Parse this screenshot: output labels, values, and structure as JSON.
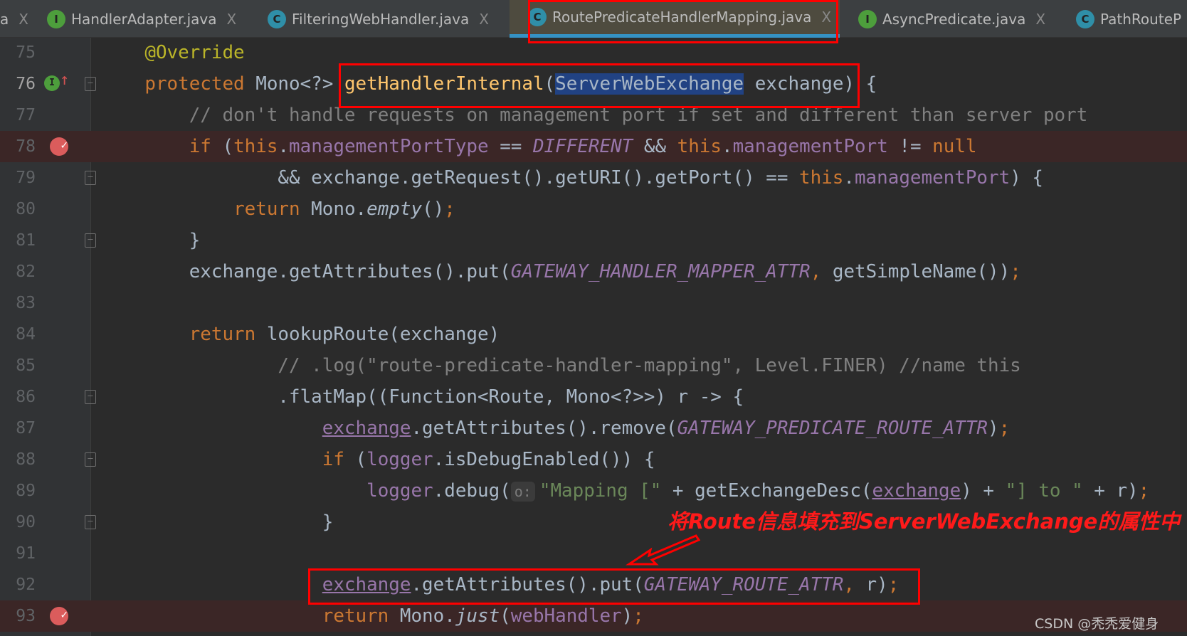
{
  "tabs": [
    {
      "label": "a",
      "icon": "",
      "close": "X"
    },
    {
      "label": "HandlerAdapter.java",
      "icon": "I",
      "close": "X"
    },
    {
      "label": "FilteringWebHandler.java",
      "icon": "C",
      "close": "X"
    },
    {
      "label": "RoutePredicateHandlerMapping.java",
      "icon": "C",
      "close": "X",
      "active": true
    },
    {
      "label": "AsyncPredicate.java",
      "icon": "I",
      "close": "X"
    },
    {
      "label": "PathRouteP",
      "icon": "C"
    }
  ],
  "lines": [
    {
      "n": "75",
      "tokens": [
        [
          "    ",
          ""
        ],
        [
          "@Override",
          "ann"
        ]
      ]
    },
    {
      "n": "76",
      "current": true,
      "gutter": "override",
      "fold": true,
      "tokens": [
        [
          "    ",
          ""
        ],
        [
          "protected",
          "kw"
        ],
        [
          " Mono<?> ",
          ""
        ],
        [
          "getHandlerInternal",
          "fn"
        ],
        [
          "(",
          ""
        ],
        [
          "ServerWebExchange",
          "sel"
        ],
        [
          " exchange) {",
          ""
        ]
      ]
    },
    {
      "n": "77",
      "tokens": [
        [
          "        ",
          ""
        ],
        [
          "// don't handle requests on management port if set and different than server port",
          "cmt"
        ]
      ]
    },
    {
      "n": "78",
      "breakpoint": true,
      "tokens": [
        [
          "        ",
          ""
        ],
        [
          "if",
          "kw"
        ],
        [
          " (",
          ""
        ],
        [
          "this",
          "kw"
        ],
        [
          ".",
          ""
        ],
        [
          "managementPortType",
          "field"
        ],
        [
          " == ",
          ""
        ],
        [
          "DIFFERENT",
          "const"
        ],
        [
          " && ",
          ""
        ],
        [
          "this",
          "kw"
        ],
        [
          ".",
          ""
        ],
        [
          "managementPort",
          "field"
        ],
        [
          " != ",
          ""
        ],
        [
          "null",
          "kw"
        ]
      ]
    },
    {
      "n": "79",
      "fold": true,
      "tokens": [
        [
          "                && exchange.getRequest().getURI().getPort() == ",
          ""
        ],
        [
          "this",
          "kw"
        ],
        [
          ".",
          ""
        ],
        [
          "managementPort",
          "field"
        ],
        [
          ") {",
          ""
        ]
      ]
    },
    {
      "n": "80",
      "tokens": [
        [
          "            ",
          ""
        ],
        [
          "return",
          "kw"
        ],
        [
          " Mono.",
          ""
        ],
        [
          "empty",
          "it"
        ],
        [
          "()",
          ""
        ],
        [
          ";",
          "kw"
        ]
      ]
    },
    {
      "n": "81",
      "fold": true,
      "tokens": [
        [
          "        }",
          ""
        ]
      ]
    },
    {
      "n": "82",
      "tokens": [
        [
          "        exchange.getAttributes().put(",
          ""
        ],
        [
          "GATEWAY_HANDLER_MAPPER_ATTR",
          "const"
        ],
        [
          ", ",
          "kw"
        ],
        [
          "getSimpleName())",
          ""
        ],
        [
          ";",
          "kw"
        ]
      ]
    },
    {
      "n": "83",
      "tokens": []
    },
    {
      "n": "84",
      "tokens": [
        [
          "        ",
          ""
        ],
        [
          "return",
          "kw"
        ],
        [
          " lookupRoute(exchange)",
          ""
        ]
      ]
    },
    {
      "n": "85",
      "tokens": [
        [
          "                ",
          ""
        ],
        [
          "// .log(\"route-predicate-handler-mapping\", Level.FINER) //name this",
          "cmt"
        ]
      ]
    },
    {
      "n": "86",
      "fold": true,
      "tokens": [
        [
          "                .flatMap((Function<Route, Mono<?>>) r -> {",
          ""
        ]
      ]
    },
    {
      "n": "87",
      "tokens": [
        [
          "                    ",
          ""
        ],
        [
          "exchange",
          "fu"
        ],
        [
          ".getAttributes().remove(",
          ""
        ],
        [
          "GATEWAY_PREDICATE_ROUTE_ATTR",
          "const"
        ],
        [
          ")",
          ""
        ],
        [
          ";",
          "kw"
        ]
      ]
    },
    {
      "n": "88",
      "fold": true,
      "tokens": [
        [
          "                    ",
          ""
        ],
        [
          "if",
          "kw"
        ],
        [
          " (",
          ""
        ],
        [
          "logger",
          "field"
        ],
        [
          ".isDebugEnabled()) {",
          ""
        ]
      ]
    },
    {
      "n": "89",
      "tokens": [
        [
          "                        ",
          ""
        ],
        [
          "logger",
          "field"
        ],
        [
          ".debug(",
          ""
        ],
        [
          "o:",
          "hint"
        ],
        [
          "\"Mapping [\"",
          "str"
        ],
        [
          " + getExchangeDesc(",
          ""
        ],
        [
          "exchange",
          "fu"
        ],
        [
          ") + ",
          ""
        ],
        [
          "\"] to \"",
          "str"
        ],
        [
          " + r)",
          ""
        ],
        [
          ";",
          "kw"
        ]
      ]
    },
    {
      "n": "90",
      "fold": true,
      "tokens": [
        [
          "                    }",
          ""
        ]
      ]
    },
    {
      "n": "91",
      "tokens": []
    },
    {
      "n": "92",
      "tokens": [
        [
          "                    ",
          ""
        ],
        [
          "exchange",
          "fu"
        ],
        [
          ".getAttributes().put(",
          ""
        ],
        [
          "GATEWAY_ROUTE_ATTR",
          "const"
        ],
        [
          ",",
          "kw"
        ],
        [
          " r)",
          ""
        ],
        [
          ";",
          "kw"
        ]
      ]
    },
    {
      "n": "93",
      "breakpoint": true,
      "tokens": [
        [
          "                    ",
          ""
        ],
        [
          "return",
          "kw"
        ],
        [
          " Mono.",
          ""
        ],
        [
          "just",
          "it"
        ],
        [
          "(",
          ""
        ],
        [
          "webHandler",
          "field"
        ],
        [
          ")",
          ""
        ],
        [
          ";",
          "kw"
        ]
      ]
    }
  ],
  "annotation": {
    "note": "将Route信息填充到ServerWebExchange的属性中",
    "color": "#ff0000"
  },
  "watermark": "CSDN @秃秃爱健身"
}
